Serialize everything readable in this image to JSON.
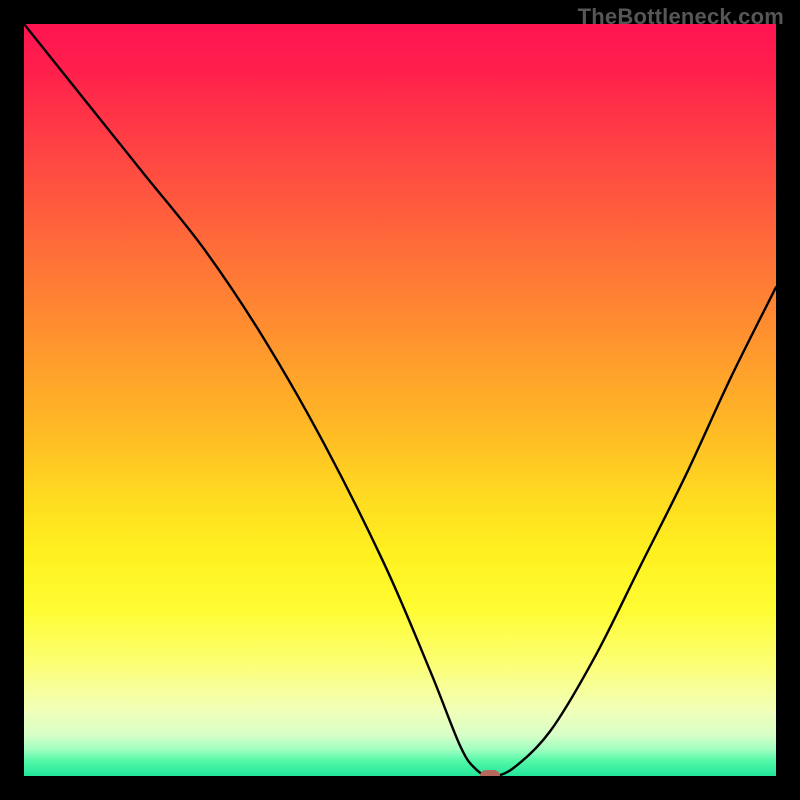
{
  "watermark": "TheBottleneck.com",
  "chart_data": {
    "type": "line",
    "title": "",
    "xlabel": "",
    "ylabel": "",
    "xlim": [
      0,
      100
    ],
    "ylim": [
      0,
      100
    ],
    "grid": false,
    "series": [
      {
        "name": "bottleneck-curve",
        "x": [
          0,
          8,
          16,
          24,
          32,
          40,
          48,
          54,
          58,
          60,
          62,
          65,
          70,
          76,
          82,
          88,
          94,
          100
        ],
        "values": [
          100,
          90,
          80,
          70,
          58,
          44,
          28,
          14,
          4,
          1,
          0,
          1,
          6,
          16,
          28,
          40,
          53,
          65
        ]
      }
    ],
    "marker": {
      "x": 62,
      "y": 0
    },
    "legend_position": "none"
  },
  "colors": {
    "curve": "#000000",
    "marker": "#b7685e",
    "frame": "#000000"
  }
}
